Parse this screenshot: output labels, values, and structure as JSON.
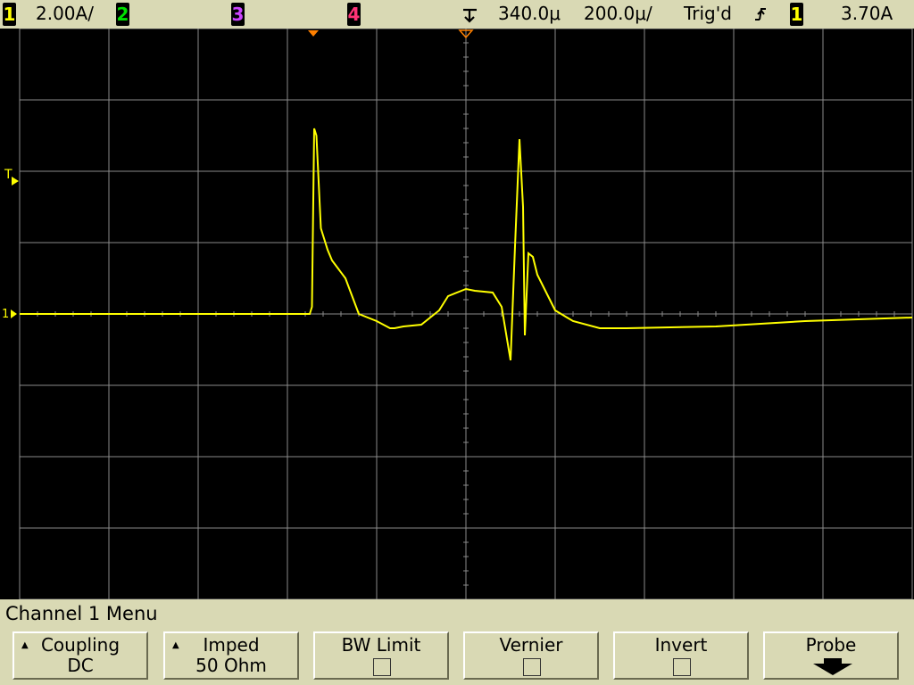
{
  "status_bar": {
    "ch1_number": "1",
    "ch1_scale": "2.00A/",
    "ch2_number": "2",
    "ch3_number": "3",
    "ch4_number": "4",
    "time_position": "340.0μ",
    "time_scale": "200.0μ/",
    "trigger_status": "Trig'd",
    "trigger_channel": "1",
    "trigger_level": "3.70A"
  },
  "markers": {
    "trigger_level_marker": "T",
    "ground_marker": "1"
  },
  "menu": {
    "title": "Channel 1  Menu"
  },
  "softkeys": [
    {
      "label": "Coupling",
      "value": "DC"
    },
    {
      "label": "Imped",
      "value": "50 Ohm"
    },
    {
      "label": "BW Limit",
      "value": ""
    },
    {
      "label": "Vernier",
      "value": ""
    },
    {
      "label": "Invert",
      "value": ""
    },
    {
      "label": "Probe",
      "value": ""
    }
  ],
  "colors": {
    "trace_ch1": "#ffff00",
    "background": "#000000",
    "grid": "#8a8a8a",
    "panel": "#d9d9b4",
    "marker_orange": "#ff8000"
  },
  "chart_data": {
    "type": "line",
    "title": "",
    "xlabel": "",
    "ylabel": "",
    "x_unit": "μs",
    "y_unit": "A",
    "xlim": [
      -660,
      1340
    ],
    "ylim": [
      -8,
      8
    ],
    "series": [
      {
        "x": [
          -660,
          -200,
          -10,
          -5,
          0,
          5,
          15,
          30,
          40,
          70,
          100,
          140,
          170,
          180,
          200,
          240,
          280,
          300,
          340,
          360,
          400,
          420,
          440,
          450,
          460,
          468,
          472,
          480,
          490,
          500,
          520,
          540,
          580,
          640,
          700,
          900,
          1100,
          1340
        ],
        "y": [
          0,
          0,
          0,
          0.2,
          5.2,
          5.0,
          2.4,
          1.8,
          1.5,
          1.0,
          0.0,
          -0.2,
          -0.4,
          -0.4,
          -0.35,
          -0.3,
          0.1,
          0.5,
          0.7,
          0.65,
          0.6,
          0.2,
          -1.3,
          1.9,
          4.9,
          3.0,
          -0.6,
          1.7,
          1.6,
          1.1,
          0.6,
          0.1,
          -0.2,
          -0.4,
          -0.4,
          -0.35,
          -0.2,
          -0.1
        ]
      }
    ]
  }
}
